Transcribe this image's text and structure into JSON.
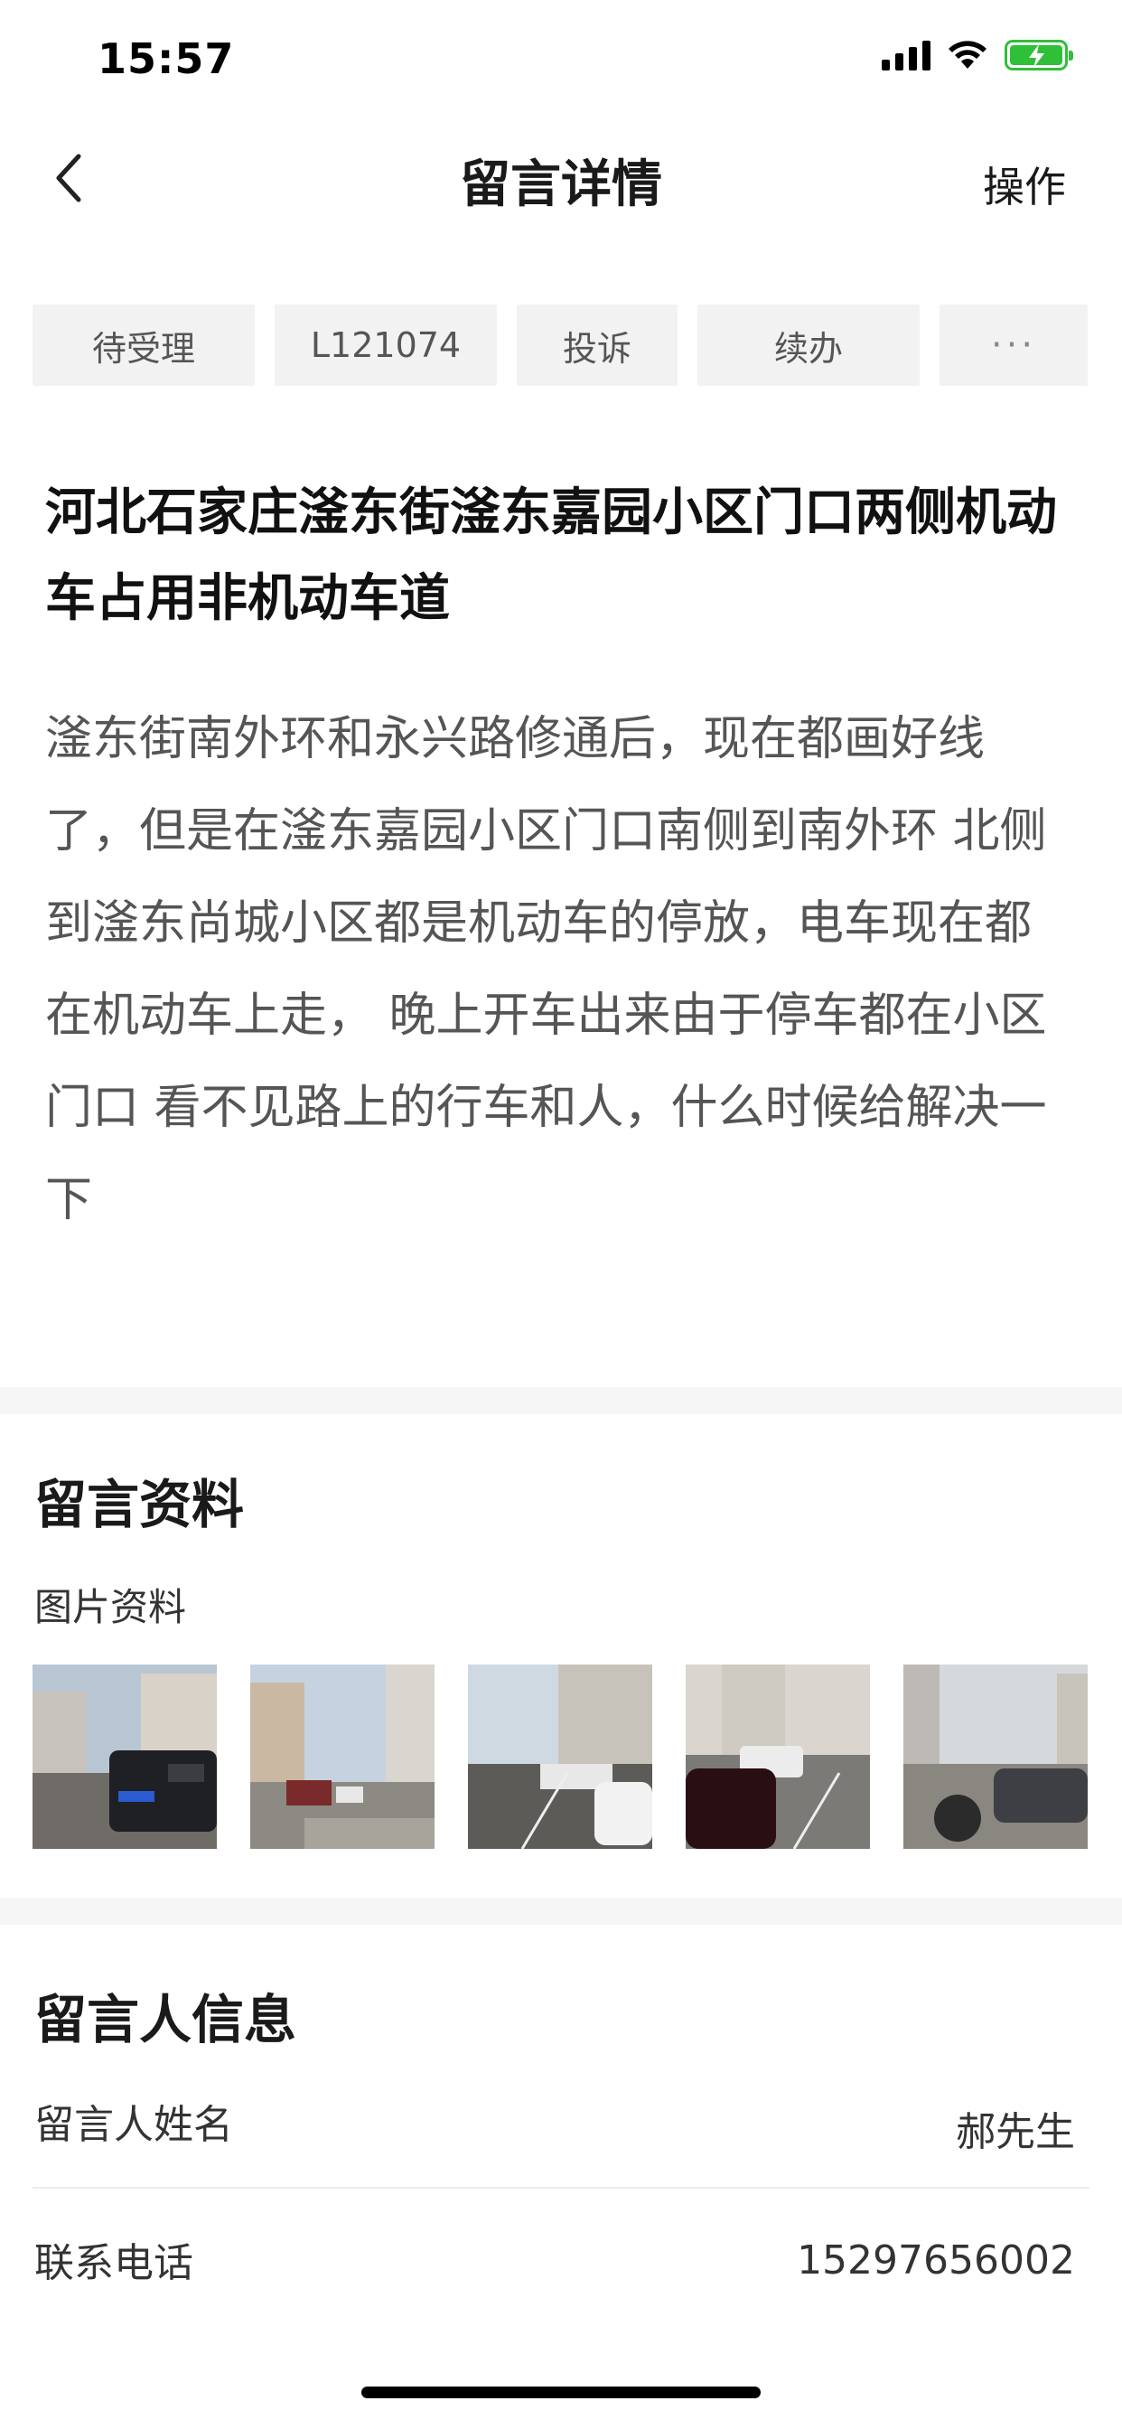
{
  "status_bar": {
    "time": "15:57",
    "battery_color": "#2fbf38"
  },
  "nav": {
    "title": "留言详情",
    "action_label": "操作",
    "back_icon": "chevron-left-icon"
  },
  "tags": [
    {
      "label": "待受理"
    },
    {
      "label": "L121074"
    },
    {
      "label": "投诉"
    },
    {
      "label": "续办"
    },
    {
      "label": "···"
    }
  ],
  "message": {
    "title": "河北石家庄滏东街滏东嘉园小区门口两侧机动车占用非机动车道",
    "content": "滏东街南外环和永兴路修通后，现在都画好线了，但是在滏东嘉园小区门口南侧到南外环 北侧到滏东尚城小区都是机动车的停放，电车现在都在机动车上走， 晚上开车出来由于停车都在小区门口 看不见路上的行车和人，什么时候给解决一下"
  },
  "materials": {
    "section_title": "留言资料",
    "images_label": "图片资料",
    "image_count": 5
  },
  "author_info": {
    "section_title": "留言人信息",
    "rows": [
      {
        "label": "留言人姓名",
        "value": "郝先生"
      },
      {
        "label": "联系电话",
        "value": "15297656002"
      }
    ]
  }
}
